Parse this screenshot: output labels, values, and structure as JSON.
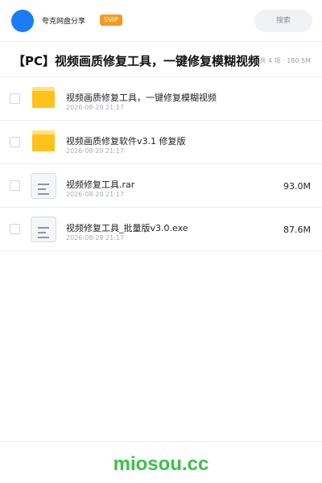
{
  "header": {
    "brand": "夸克网盘分享",
    "badge": "SVIP",
    "search_label": "搜索"
  },
  "share": {
    "title": "【PC】视频画质修复工具，一键修复模糊视频",
    "meta": "共 4 项 · 180.5M"
  },
  "files": [
    {
      "name": "视频画质修复工具，一键修复模糊视频",
      "date": "2026-08-29 21:17",
      "size": "",
      "type": "folder",
      "icon": "folder-icon"
    },
    {
      "name": "视频画质修复软件v3.1 修复版",
      "date": "2026-08-29 21:17",
      "size": "",
      "type": "folder",
      "icon": "folder-icon"
    },
    {
      "name": "视频修复工具.rar",
      "date": "2026-08-29 21:17",
      "size": "93.0M",
      "type": "file",
      "icon": "file-icon"
    },
    {
      "name": "视频修复工具_批量版v3.0.exe",
      "date": "2026-08-29 21:17",
      "size": "87.6M",
      "type": "file",
      "icon": "file-icon"
    }
  ],
  "footer": {
    "watermark": "miosou.cc"
  },
  "colors": {
    "accent": "#1b7df5",
    "svip": "#f39a23",
    "folder": "#ffc21a",
    "watermark": "#3dbf4a"
  }
}
